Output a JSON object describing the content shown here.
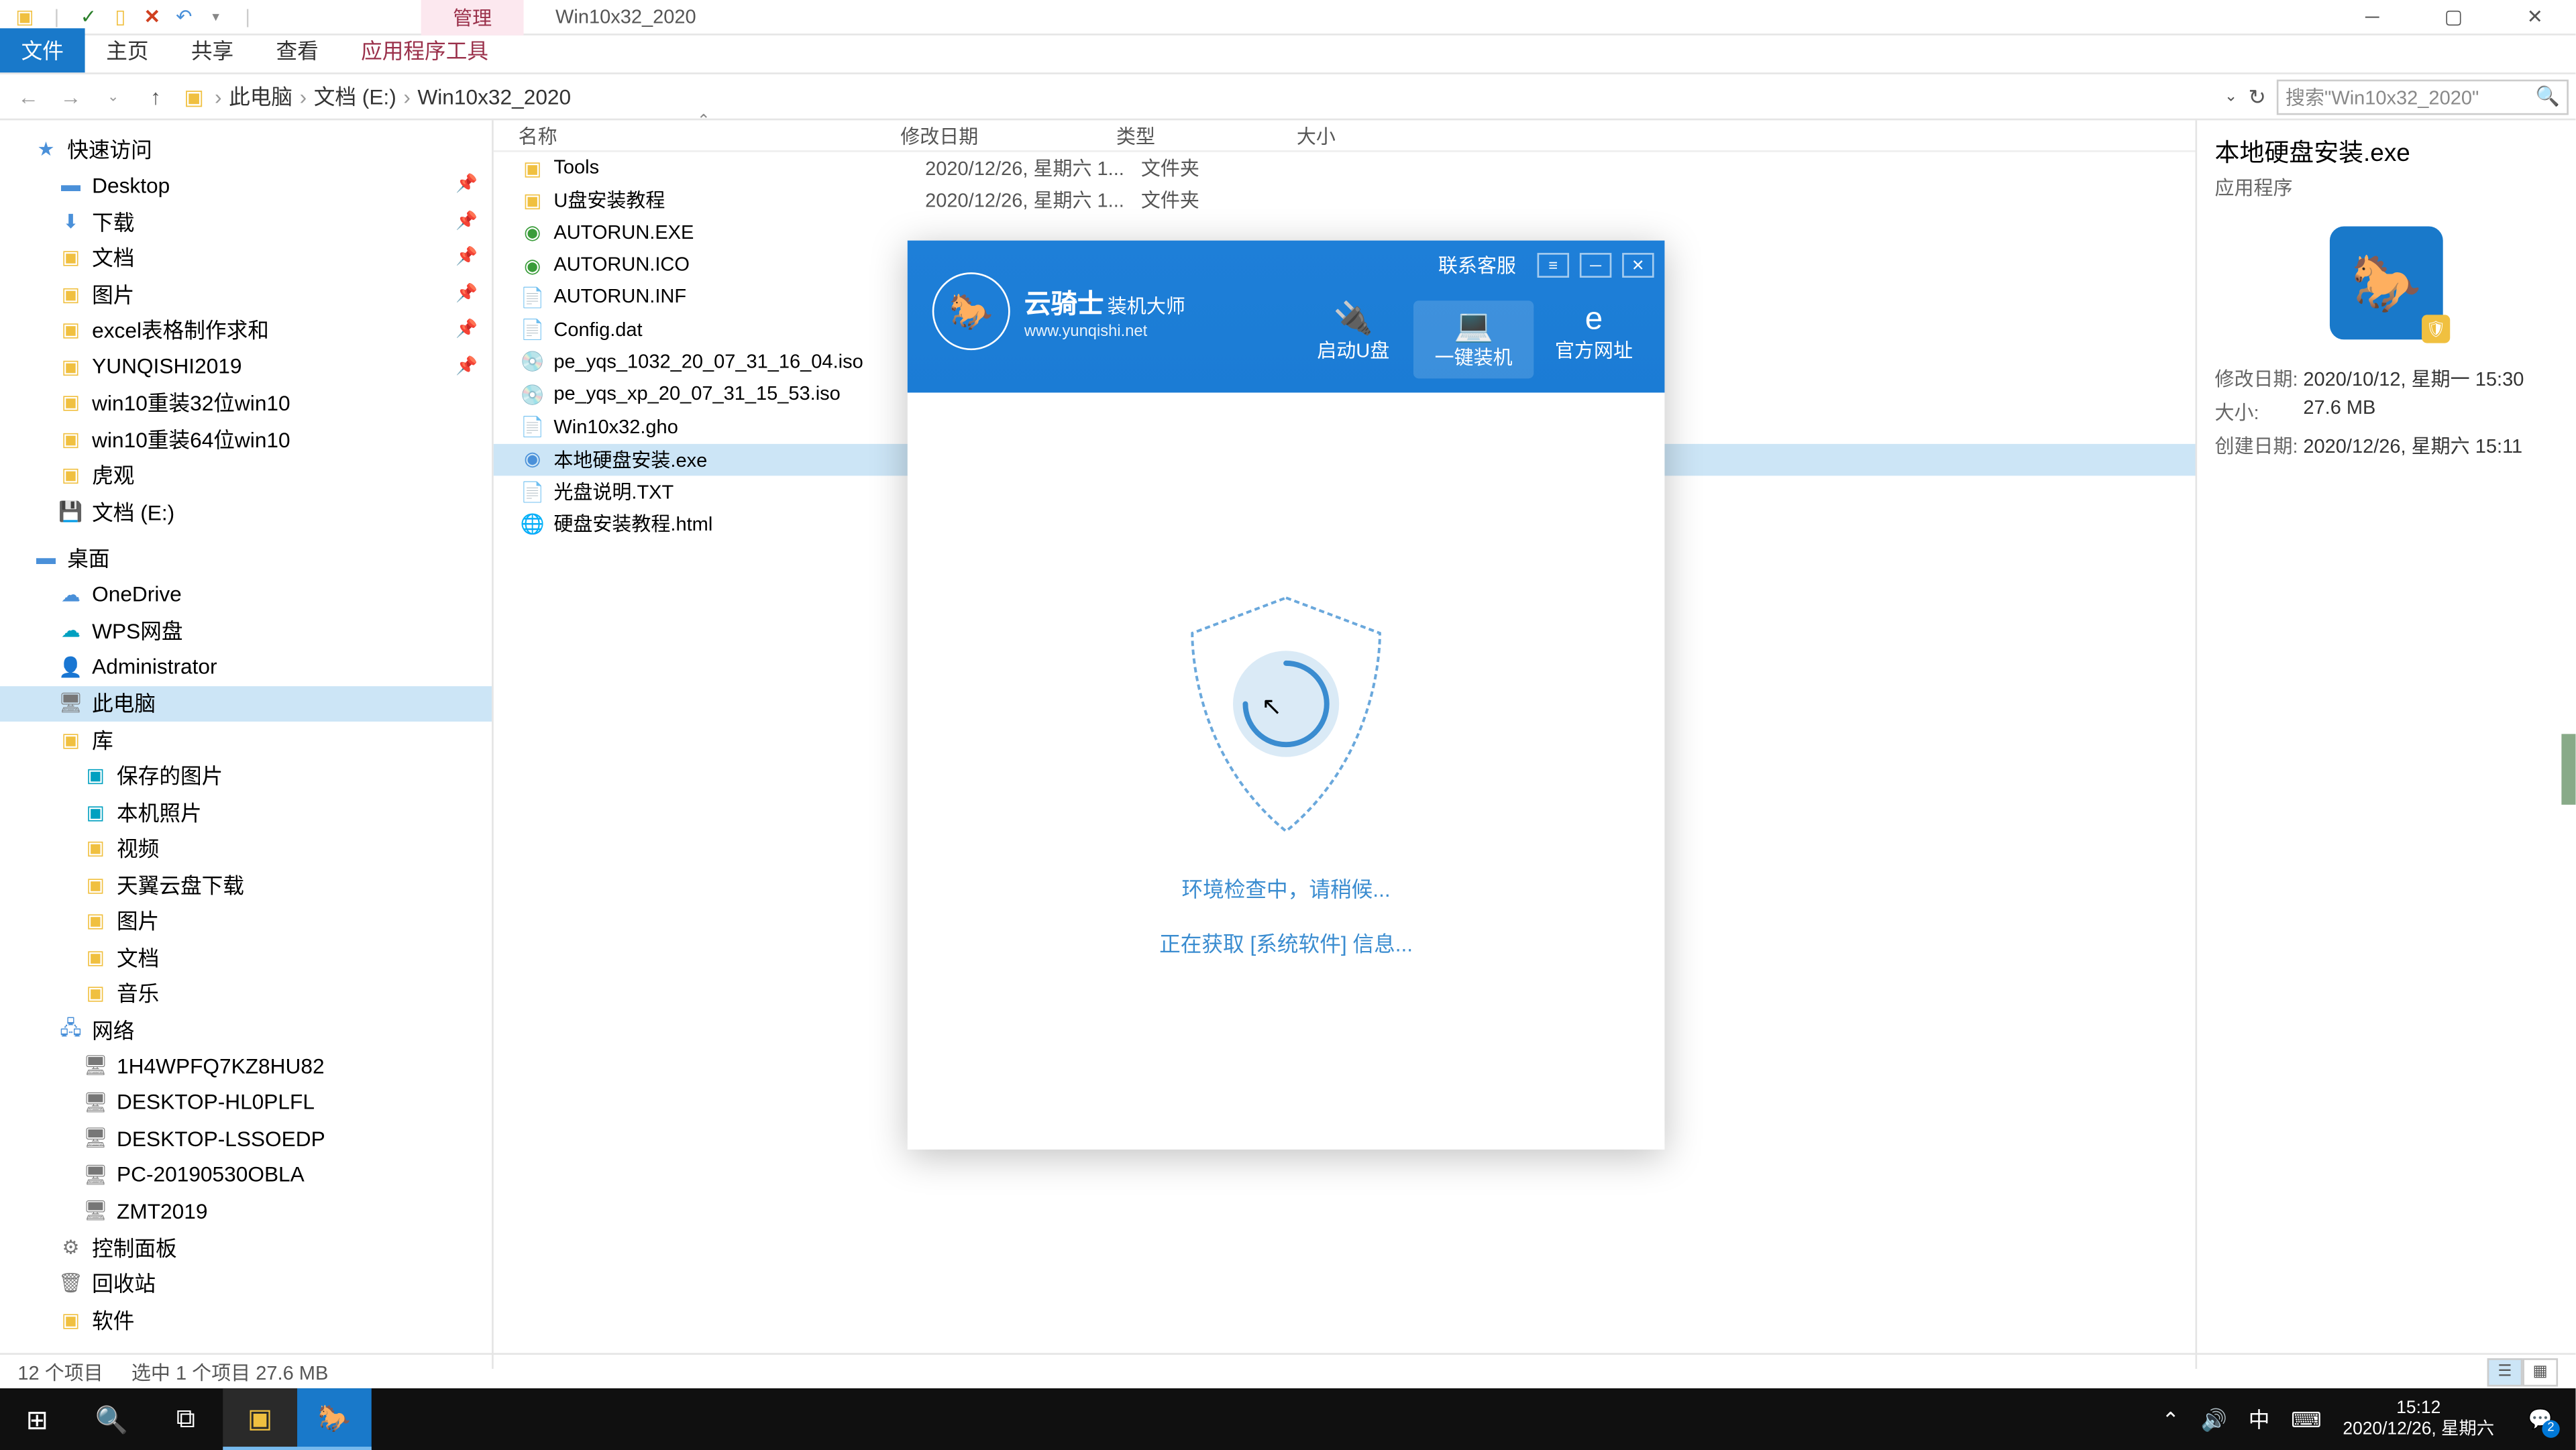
{
  "window": {
    "tab_mgmt": "管理",
    "tab_title": "Win10x32_2020"
  },
  "ribbon": {
    "file": "文件",
    "home": "主页",
    "share": "共享",
    "view": "查看",
    "mgmt_tools": "应用程序工具"
  },
  "breadcrumb": {
    "pc": "此电脑",
    "drive": "文档 (E:)",
    "folder": "Win10x32_2020"
  },
  "search": {
    "placeholder": "搜索\"Win10x32_2020\""
  },
  "sidebar": {
    "quick_access": "快速访问",
    "desktop": "Desktop",
    "downloads": "下载",
    "documents": "文档",
    "pictures": "图片",
    "excel": "excel表格制作求和",
    "yunqishi": "YUNQISHI2019",
    "win10_32": "win10重装32位win10",
    "win10_64": "win10重装64位win10",
    "huguan": "虎观",
    "doc_e": "文档 (E:)",
    "desk_cn": "桌面",
    "onedrive": "OneDrive",
    "wps": "WPS网盘",
    "admin": "Administrator",
    "this_pc": "此电脑",
    "library": "库",
    "saved_pics": "保存的图片",
    "local_pics": "本机照片",
    "video": "视频",
    "tianyi": "天翼云盘下载",
    "pics": "图片",
    "docs": "文档",
    "music": "音乐",
    "network": "网络",
    "net1": "1H4WPFQ7KZ8HU82",
    "net2": "DESKTOP-HL0PLFL",
    "net3": "DESKTOP-LSSOEDP",
    "net4": "PC-20190530OBLA",
    "net5": "ZMT2019",
    "control": "控制面板",
    "recycle": "回收站",
    "software": "软件"
  },
  "columns": {
    "name": "名称",
    "date": "修改日期",
    "type": "类型",
    "size": "大小"
  },
  "files": [
    {
      "icon": "folder",
      "name": "Tools",
      "date": "2020/12/26, 星期六 1...",
      "type": "文件夹"
    },
    {
      "icon": "folder",
      "name": "U盘安装教程",
      "date": "2020/12/26, 星期六 1...",
      "type": "文件夹"
    },
    {
      "icon": "exe-green",
      "name": "AUTORUN.EXE",
      "date": "",
      "type": ""
    },
    {
      "icon": "ico-green",
      "name": "AUTORUN.ICO",
      "date": "",
      "type": ""
    },
    {
      "icon": "inf",
      "name": "AUTORUN.INF",
      "date": "",
      "type": ""
    },
    {
      "icon": "file",
      "name": "Config.dat",
      "date": "",
      "type": ""
    },
    {
      "icon": "iso",
      "name": "pe_yqs_1032_20_07_31_16_04.iso",
      "date": "",
      "type": ""
    },
    {
      "icon": "iso",
      "name": "pe_yqs_xp_20_07_31_15_53.iso",
      "date": "",
      "type": ""
    },
    {
      "icon": "file",
      "name": "Win10x32.gho",
      "date": "",
      "type": ""
    },
    {
      "icon": "app-blue",
      "name": "本地硬盘安装.exe",
      "date": "",
      "type": "",
      "selected": true
    },
    {
      "icon": "txt-green",
      "name": "光盘说明.TXT",
      "date": "",
      "type": ""
    },
    {
      "icon": "html",
      "name": "硬盘安装教程.html",
      "date": "",
      "type": ""
    }
  ],
  "details": {
    "title": "本地硬盘安装.exe",
    "type": "应用程序",
    "mod_label": "修改日期:",
    "mod_val": "2020/10/12, 星期一 15:30",
    "size_label": "大小:",
    "size_val": "27.6 MB",
    "create_label": "创建日期:",
    "create_val": "2020/12/26, 星期六 15:11"
  },
  "status": {
    "count": "12 个项目",
    "selected": "选中 1 个项目  27.6 MB"
  },
  "dialog": {
    "contact": "联系客服",
    "brand": "云骑士",
    "brand_sub": "装机大师",
    "url": "www.yunqishi.net",
    "nav_usb": "启动U盘",
    "nav_install": "一键装机",
    "nav_web": "官方网址",
    "msg1": "环境检查中，请稍候...",
    "msg2": "正在获取 [系统软件] 信息..."
  },
  "taskbar": {
    "time": "15:12",
    "date": "2020/12/26, 星期六",
    "ime": "中",
    "notif_count": "2"
  }
}
